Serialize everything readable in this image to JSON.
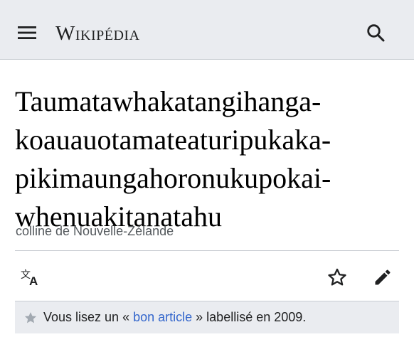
{
  "header": {
    "logo": "Wikipédia",
    "menu_icon": "hamburger-menu-icon",
    "search_icon": "search-icon"
  },
  "article": {
    "title_lines": [
      "Taumatawhakatangihanga-",
      "koauauotamateaturipukaka-",
      "pikimaungahoronukupokai-",
      "whenuakitanatahu"
    ],
    "description": "colline de Nouvelle-Zélande"
  },
  "actions": {
    "language_icon": "language-icon",
    "watch_icon": "star-icon",
    "edit_icon": "edit-pencil-icon"
  },
  "notice": {
    "icon": "star-icon",
    "text_before": "Vous lisez un « ",
    "link_text": "bon article",
    "text_after": " » labellisé en 2009."
  },
  "colors": {
    "header_bg": "#eaecf0",
    "link": "#3366cc",
    "text": "#202122",
    "muted": "#54595d",
    "icon": "#202122",
    "notice_star": "#a2a9b1"
  }
}
